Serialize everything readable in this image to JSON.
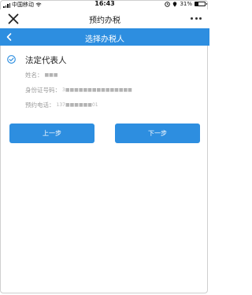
{
  "status_bar": {
    "carrier": "中国移动",
    "time": "16:43",
    "battery": "31%",
    "battery_level": 0.31
  },
  "app_bar": {
    "title": "预约办税",
    "close_icon": "close-icon",
    "more_icon": "more-icon"
  },
  "nav_bar": {
    "title": "选择办税人",
    "back_icon": "chevron-left-icon"
  },
  "taxpayer": {
    "role": "法定代表人",
    "name_label": "姓名：",
    "name_value": "■■■",
    "id_label": "身份证号码：",
    "id_value": "3■■■■■■■■■■■■■■■",
    "phone_label": "预约电话：",
    "phone_value": "137■■■■■■01"
  },
  "buttons": {
    "prev_label": "上一步",
    "next_label": "下一步"
  },
  "colors": {
    "accent": "#2d8ee0",
    "background": "#ffffff"
  }
}
